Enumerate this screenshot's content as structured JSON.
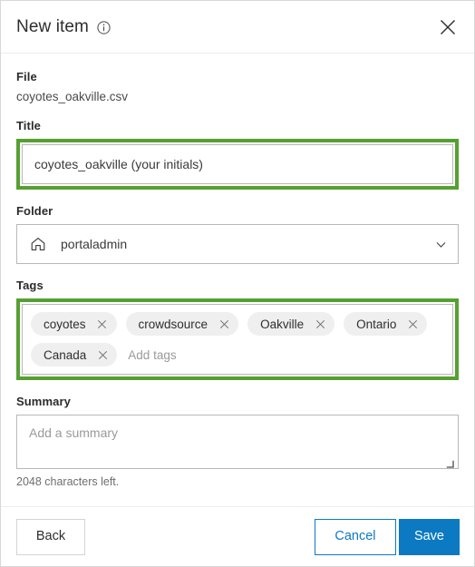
{
  "dialog": {
    "title": "New item",
    "info_icon": "info-circle-icon",
    "close_icon": "close-icon"
  },
  "fields": {
    "file": {
      "label": "File",
      "value": "coyotes_oakville.csv"
    },
    "title": {
      "label": "Title",
      "value": "coyotes_oakville (your initials)",
      "placeholder": "Title"
    },
    "folder": {
      "label": "Folder",
      "value": "portaladmin",
      "icon": "home-icon",
      "chevron_icon": "chevron-down-icon"
    },
    "tags": {
      "label": "Tags",
      "items": [
        {
          "label": "coyotes",
          "remove_icon": "close-icon"
        },
        {
          "label": "crowdsource",
          "remove_icon": "close-icon"
        },
        {
          "label": "Oakville",
          "remove_icon": "close-icon"
        },
        {
          "label": "Ontario",
          "remove_icon": "close-icon"
        },
        {
          "label": "Canada",
          "remove_icon": "close-icon"
        }
      ],
      "placeholder": "Add tags"
    },
    "summary": {
      "label": "Summary",
      "value": "",
      "placeholder": "Add a summary",
      "char_count": "2048 characters left.",
      "resize_icon": "resize-handle-icon"
    }
  },
  "footer": {
    "back_label": "Back",
    "cancel_label": "Cancel",
    "save_label": "Save"
  },
  "colors": {
    "accent_blue": "#0c7ac2",
    "highlight_green": "#56a032",
    "chip_gray": "#efefef",
    "border_gray": "#b8b8b8"
  }
}
